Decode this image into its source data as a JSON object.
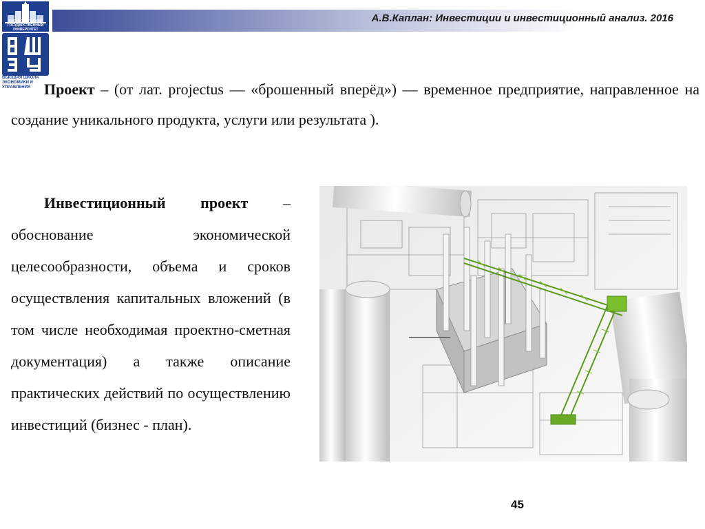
{
  "header": {
    "title": "А.В.Каплан: Инвестиции и инвестиционный анализ. 2016"
  },
  "logo": {
    "top_caption": "ЮЖНО-УРАЛЬСКИЙ ГОСУДАРСТВЕННЫЙ УНИВЕРСИТЕТ",
    "emblem_text": "ВШЭУ",
    "bottom_caption": "ВЫСШАЯ ШКОЛА ЭКОНОМИКИ И УПРАВЛЕНИЯ"
  },
  "content": {
    "para1_term": "Проект",
    "para1_text": " – (от лат. projectus — «брошенный вперёд») — временное предприятие, направленное на создание уникального продукта, услуги или результата ).",
    "para2_term": "Инвестиционный проект",
    "para2_text": " – обоснование экономической целесообразности, объема и сроков осуществления капитальных вложений (в том числе необходимая проектно-сметная документация) а также описание практических действий по осуществлению инвестиций (бизнес - план)."
  },
  "image": {
    "subject": "construction-blueprints-crane-illustration"
  },
  "page_number": "45",
  "colors": {
    "header_dark": "#2c3b8f",
    "logo_blue": "#1f3f91",
    "crane_green": "#7cbf2e"
  }
}
